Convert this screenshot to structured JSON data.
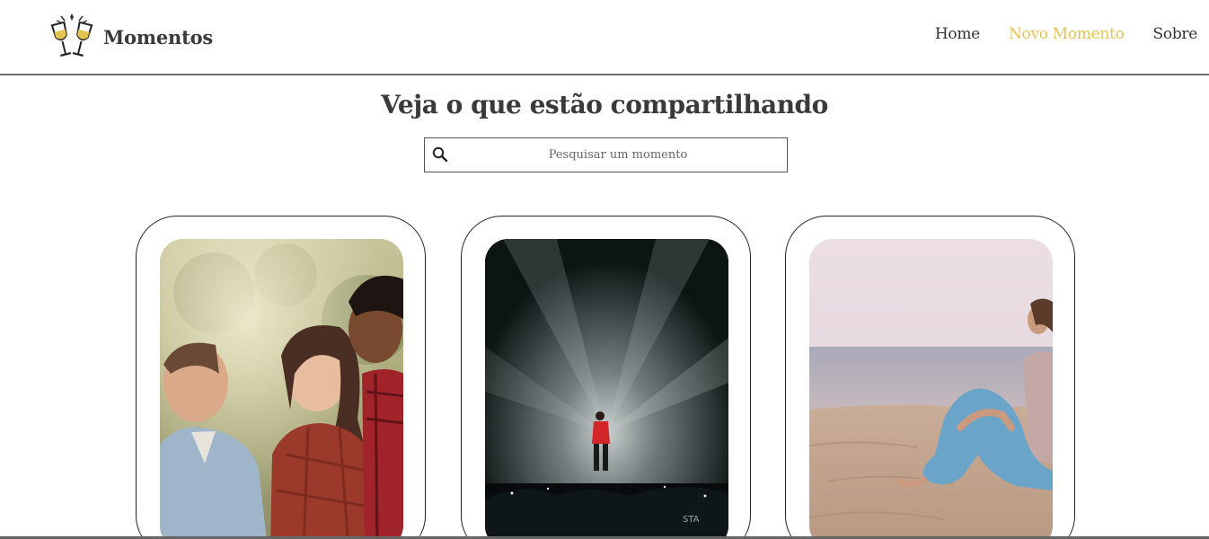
{
  "app": {
    "brand_name": "Momentos",
    "logo_icon": "champagne-toast-icon",
    "accent_color": "#e3c450"
  },
  "nav": {
    "items": [
      {
        "label": "Home",
        "active": false
      },
      {
        "label": "Novo Momento",
        "active": true
      },
      {
        "label": "Sobre",
        "active": false
      }
    ]
  },
  "main": {
    "title": "Veja o que estão compartilhando",
    "search": {
      "placeholder": "Pesquisar um momento",
      "value": "",
      "icon": "search-icon"
    },
    "cards": [
      {
        "image": "friends-laughing-outdoors-photo"
      },
      {
        "image": "concert-performer-spotlight-photo"
      },
      {
        "image": "woman-sitting-on-beach-photo"
      }
    ]
  }
}
